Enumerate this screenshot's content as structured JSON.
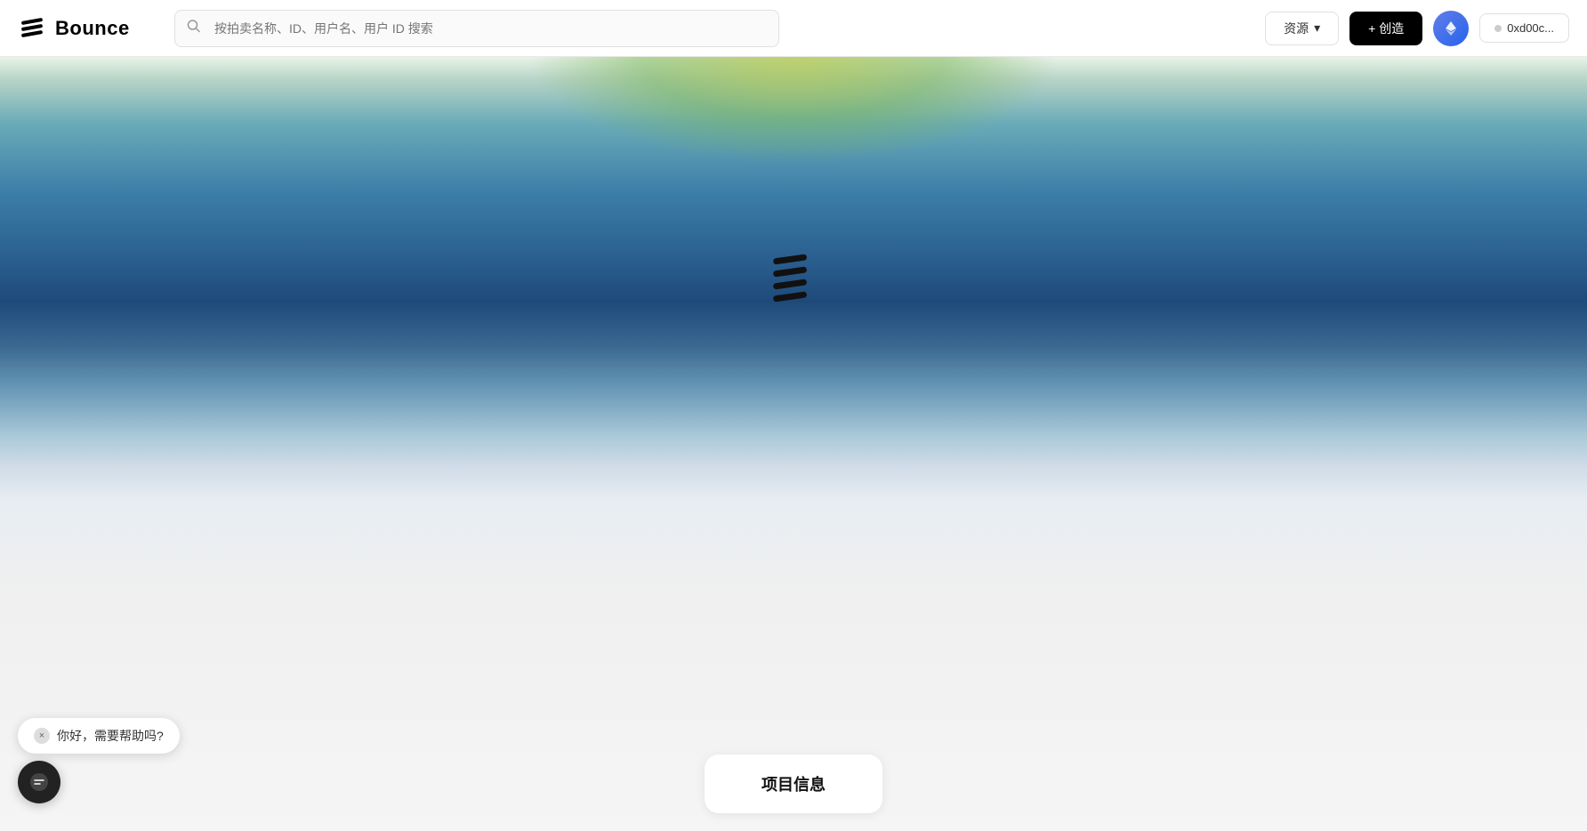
{
  "header": {
    "logo_text": "Bounce",
    "search_placeholder": "按拍卖名称、ID、用户名、用户 ID 搜索",
    "resources_label": "资源",
    "create_label": "+ 创造",
    "wallet_label": "0xd00c..."
  },
  "hero": {
    "loading_icon_alt": "Bounce loading icon"
  },
  "project_info": {
    "title": "项目信息"
  },
  "chat": {
    "message": "你好，需要帮助吗?",
    "close_label": "×"
  }
}
